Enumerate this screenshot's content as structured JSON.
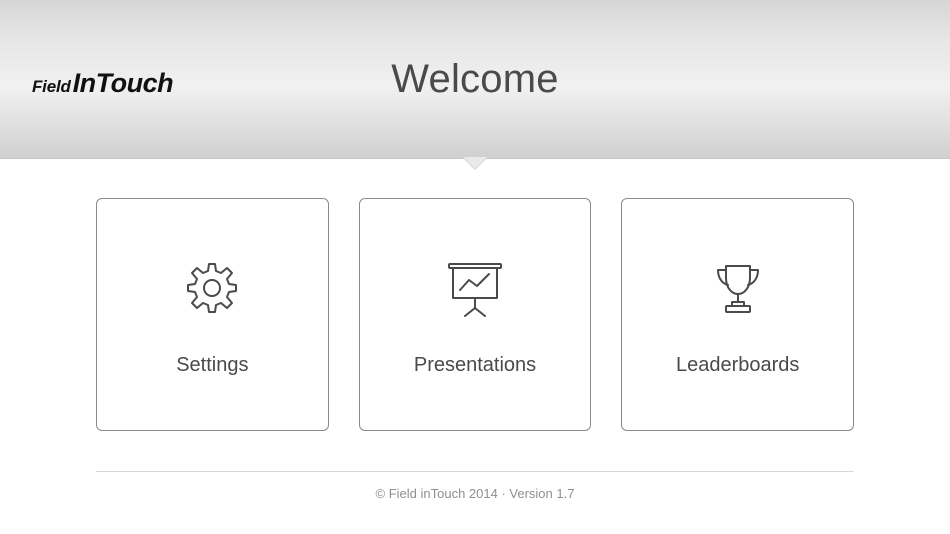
{
  "brand": {
    "part1": "Field",
    "part2": "In",
    "part3": "Touch"
  },
  "header": {
    "title": "Welcome"
  },
  "tiles": [
    {
      "label": "Settings",
      "icon": "gear-icon"
    },
    {
      "label": "Presentations",
      "icon": "presentation-icon"
    },
    {
      "label": "Leaderboards",
      "icon": "trophy-icon"
    }
  ],
  "footer": {
    "text": "© Field inTouch 2014 · Version 1.7"
  }
}
